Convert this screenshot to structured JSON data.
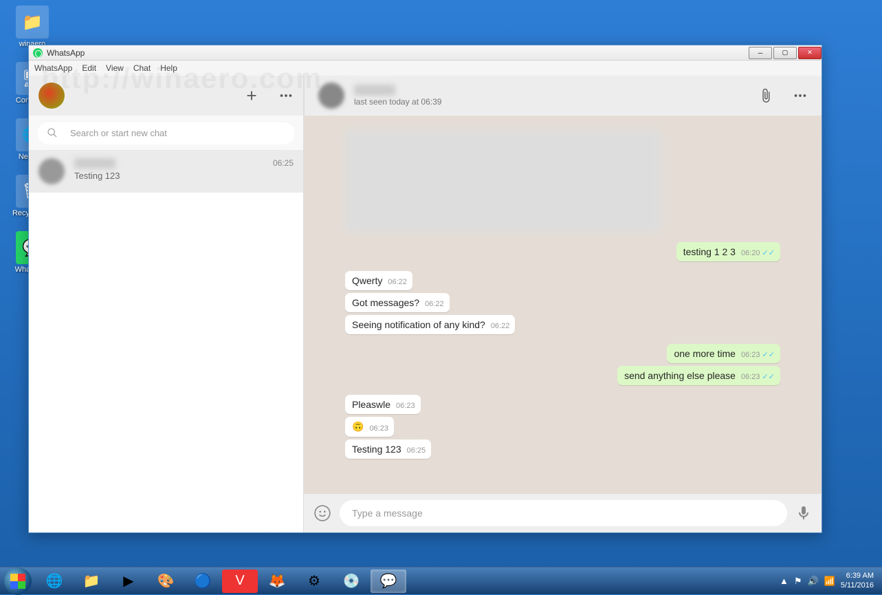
{
  "desktop": {
    "icons": [
      {
        "label": "winaero",
        "glyph": "📁"
      },
      {
        "label": "Computer",
        "glyph": "🖥"
      },
      {
        "label": "Network",
        "glyph": "🌐"
      },
      {
        "label": "Recycle Bin",
        "glyph": "🗑"
      },
      {
        "label": "WhatsApp",
        "glyph": "💬"
      }
    ]
  },
  "window": {
    "title": "WhatsApp",
    "menu": [
      "WhatsApp",
      "Edit",
      "View",
      "Chat",
      "Help"
    ]
  },
  "sidebar": {
    "search_placeholder": "Search or start new chat",
    "chat": {
      "preview": "Testing 123",
      "time": "06:25"
    }
  },
  "chat": {
    "status": "last seen today at 06:39",
    "messages": [
      {
        "dir": "out",
        "text": "testing 1 2 3",
        "time": "06:20",
        "ticks": true
      },
      {
        "dir": "in",
        "text": "Qwerty",
        "time": "06:22"
      },
      {
        "dir": "in",
        "text": "Got messages?",
        "time": "06:22"
      },
      {
        "dir": "in",
        "text": "Seeing notification of any kind?",
        "time": "06:22"
      },
      {
        "dir": "out",
        "text": "one more time",
        "time": "06:23",
        "ticks": true
      },
      {
        "dir": "out",
        "text": "send anything else please",
        "time": "06:23",
        "ticks": true
      },
      {
        "dir": "in",
        "text": "Pleaswle",
        "time": "06:23"
      },
      {
        "dir": "in",
        "text": "🙃",
        "time": "06:23"
      },
      {
        "dir": "in",
        "text": "Testing 123",
        "time": "06:25"
      }
    ],
    "compose_placeholder": "Type a message"
  },
  "taskbar": {
    "time": "6:39 AM",
    "date": "5/11/2016"
  },
  "watermark": "http://winaero.com"
}
